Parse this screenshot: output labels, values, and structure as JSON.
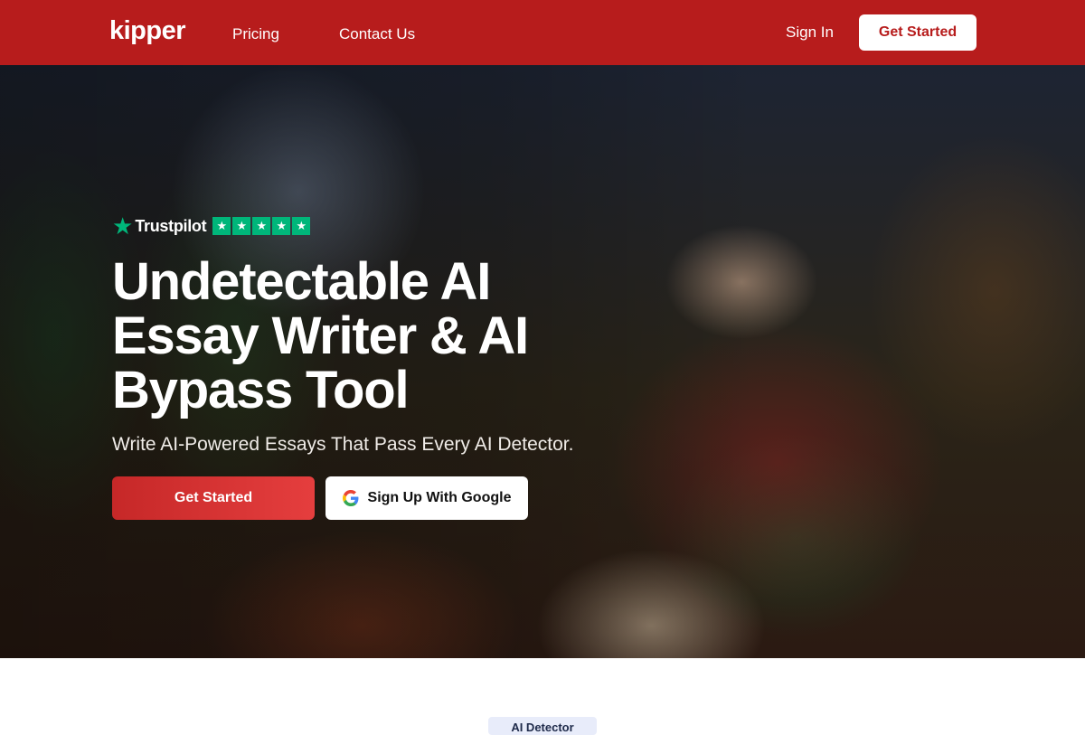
{
  "nav": {
    "logo": "kipper",
    "links": [
      {
        "label": "Pricing"
      },
      {
        "label": "Contact Us"
      }
    ],
    "sign_in": "Sign In",
    "cta": "Get Started",
    "brand_color": "#b71c1c"
  },
  "hero": {
    "trustpilot": {
      "label": "Trustpilot",
      "rating": 5,
      "stars": [
        "★",
        "★",
        "★",
        "★",
        "★"
      ],
      "color": "#00b67a"
    },
    "headline": "Undetectable AI Essay Writer & AI Bypass Tool",
    "subheadline": "Write AI-Powered Essays That Pass Every AI Detector.",
    "primary_cta": "Get Started",
    "google_cta": "Sign Up With Google",
    "google_icon": "google-g-icon"
  },
  "next_section": {
    "badge": "AI Detector"
  }
}
